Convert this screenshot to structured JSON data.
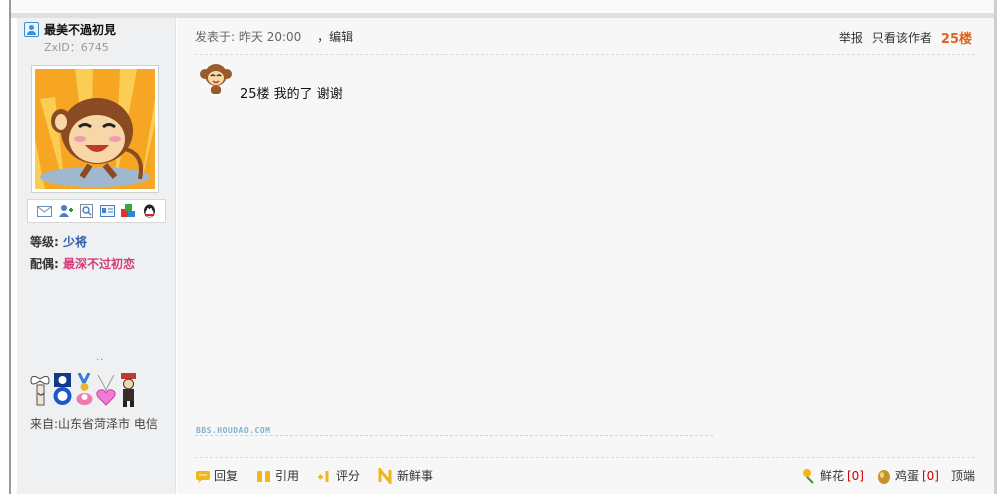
{
  "user": {
    "name": "最美不過初見",
    "zxid_label": "ZxID：",
    "zxid": "6745",
    "level_label": "等级:",
    "level": "少将",
    "spouse_label": "配偶:",
    "spouse": "最深不过初恋",
    "dots": "..",
    "from": "来自:山东省菏泽市 电信"
  },
  "post": {
    "posted_label": "发表于:",
    "posted_time": "昨天 20:00",
    "edit_label": "，编辑",
    "report": "举报",
    "only_author": "只看该作者",
    "floor": "25楼",
    "text": "25楼 我的了 谢谢",
    "sig_logo": "BBS.HOUDAO.COM"
  },
  "footer": {
    "reply": "回复",
    "quote": "引用",
    "rate": "评分",
    "news": "新鲜事",
    "flower_label": "鲜花",
    "flower_count": "[0]",
    "egg_label": "鸡蛋",
    "egg_count": "[0]",
    "top": "顶端"
  },
  "colors": {
    "sidebar_bg": "#eef0f2",
    "content_bg": "#f7f7f7",
    "floor": "#e0641e",
    "level": "#2b5da8",
    "spouse": "#d23c7a",
    "count": "#cc0000"
  },
  "icons": {
    "contact": [
      "email-icon",
      "add-friend-icon",
      "profile-icon",
      "card-icon",
      "album-icon",
      "qq-icon"
    ],
    "medals": [
      "bow-medal-icon",
      "badge-medal-icon",
      "ribbon-medal-icon",
      "heart-necklace-medal-icon",
      "figure-medal-icon"
    ]
  }
}
